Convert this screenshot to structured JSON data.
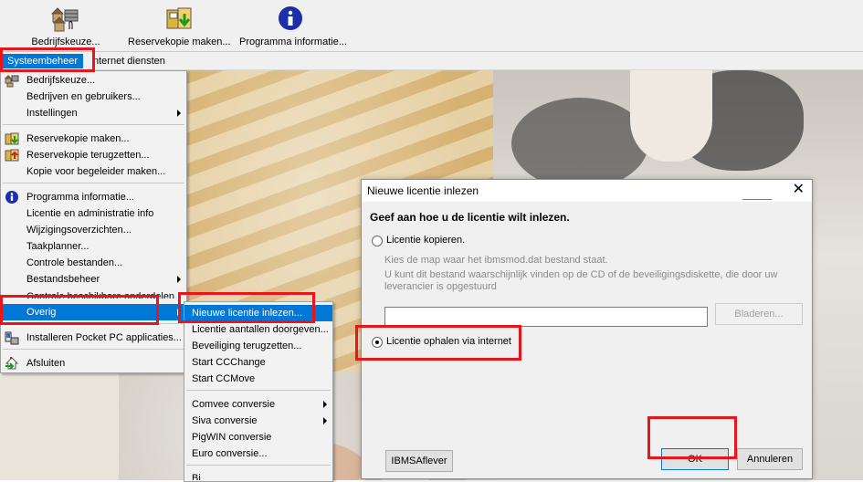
{
  "toolbar": {
    "buttons": [
      {
        "label": "Bedrijfskeuze...",
        "icon": "company-select-icon"
      },
      {
        "label": "Reservekopie maken...",
        "icon": "backup-icon"
      },
      {
        "label": "Programma informatie...",
        "icon": "info-icon"
      }
    ]
  },
  "menubar": {
    "active": "Systeembeheer",
    "items": [
      "nternet diensten"
    ]
  },
  "system_menu": {
    "items": [
      {
        "label": "Bedrijfskeuze...",
        "icon": "company-select-icon"
      },
      {
        "label": "Bedrijven en gebruikers..."
      },
      {
        "label": "Instellingen",
        "submenu": true
      },
      {
        "label": "Reservekopie maken...",
        "icon": "backup-icon"
      },
      {
        "label": "Reservekopie terugzetten...",
        "icon": "restore-icon"
      },
      {
        "label": "Kopie voor begeleider maken..."
      },
      {
        "label": "Programma informatie...",
        "icon": "info-icon"
      },
      {
        "label": "Licentie en administratie info"
      },
      {
        "label": "Wijzigingsoverzichten..."
      },
      {
        "label": "Taakplanner..."
      },
      {
        "label": "Controle bestanden..."
      },
      {
        "label": "Bestandsbeheer",
        "submenu": true
      },
      {
        "label": "Controle beschikbare onderdelen..."
      },
      {
        "label": "Overig",
        "submenu": true,
        "selected": true
      },
      {
        "label": "Installeren Pocket PC applicaties...",
        "icon": "pocket-pc-icon"
      },
      {
        "label": "Afsluiten",
        "icon": "exit-icon"
      }
    ]
  },
  "overig_submenu": {
    "items": [
      {
        "label": "Nieuwe licentie inlezen...",
        "selected": true
      },
      {
        "label": "Licentie aantallen doorgeven..."
      },
      {
        "label": "Beveiliging terugzetten..."
      },
      {
        "label": "Start CCChange"
      },
      {
        "label": "Start CCMove"
      },
      {
        "label": "Comvee conversie",
        "submenu": true
      },
      {
        "label": "Siva conversie",
        "submenu": true
      },
      {
        "label": "PigWIN conversie"
      },
      {
        "label": "Euro conversie..."
      },
      {
        "label": "Bi"
      }
    ]
  },
  "dialog": {
    "title": "Nieuwe licentie inlezen",
    "heading": "Geef aan hoe u de licentie wilt inlezen.",
    "option_copy": "Licentie kopieren.",
    "hint1": "Kies de map waar het ibmsmod.dat bestand staat.",
    "hint2": "U kunt dit bestand waarschijnlijk vinden op de CD of de beveiligingsdiskette, die door uw",
    "hint3": "leverancier is opgestuurd",
    "path_value": "",
    "browse_label": "Bladeren...",
    "option_internet": "Licentie ophalen via internet",
    "ibms_label": "IBMSAflever",
    "ok_label": "OK",
    "cancel_label": "Annuleren",
    "selected_option": "internet"
  },
  "colors": {
    "highlight": "#e8161b",
    "selection": "#0078d7"
  }
}
